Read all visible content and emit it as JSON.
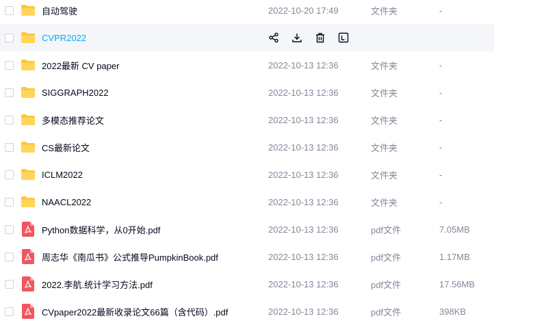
{
  "files": [
    {
      "name": "自动驾驶",
      "date": "2022-10-20 17:49",
      "type": "文件夹",
      "size": "-",
      "kind": "folder"
    },
    {
      "name": "CVPR2022",
      "date": "",
      "type": "",
      "size": "",
      "kind": "folder",
      "hovered": true
    },
    {
      "name": "2022最新 CV paper",
      "date": "2022-10-13 12:36",
      "type": "文件夹",
      "size": "-",
      "kind": "folder"
    },
    {
      "name": "SIGGRAPH2022",
      "date": "2022-10-13 12:36",
      "type": "文件夹",
      "size": "-",
      "kind": "folder"
    },
    {
      "name": "多模态推荐论文",
      "date": "2022-10-13 12:36",
      "type": "文件夹",
      "size": "-",
      "kind": "folder"
    },
    {
      "name": "CS最新论文",
      "date": "2022-10-13 12:36",
      "type": "文件夹",
      "size": "-",
      "kind": "folder"
    },
    {
      "name": "ICLM2022",
      "date": "2022-10-13 12:36",
      "type": "文件夹",
      "size": "-",
      "kind": "folder"
    },
    {
      "name": "NAACL2022",
      "date": "2022-10-13 12:36",
      "type": "文件夹",
      "size": "-",
      "kind": "folder"
    },
    {
      "name": "Python数据科学，从0开始.pdf",
      "date": "2022-10-13 12:36",
      "type": "pdf文件",
      "size": "7.05MB",
      "kind": "pdf"
    },
    {
      "name": "周志华《南瓜书》公式推导PumpkinBook.pdf",
      "date": "2022-10-13 12:36",
      "type": "pdf文件",
      "size": "1.17MB",
      "kind": "pdf"
    },
    {
      "name": "2022.李航.统计学习方法.pdf",
      "date": "2022-10-13 12:36",
      "type": "pdf文件",
      "size": "17.56MB",
      "kind": "pdf"
    },
    {
      "name": "CVpaper2022最新收录论文66篇（含代码）.pdf",
      "date": "2022-10-13 12:36",
      "type": "pdf文件",
      "size": "398KB",
      "kind": "pdf"
    }
  ],
  "colors": {
    "folder": "#ffc937",
    "pdf": "#f2555d",
    "accent": "#06a7ff",
    "muted": "#818999"
  },
  "hover_actions": [
    "share-icon",
    "download-icon",
    "delete-icon",
    "rename-icon"
  ]
}
